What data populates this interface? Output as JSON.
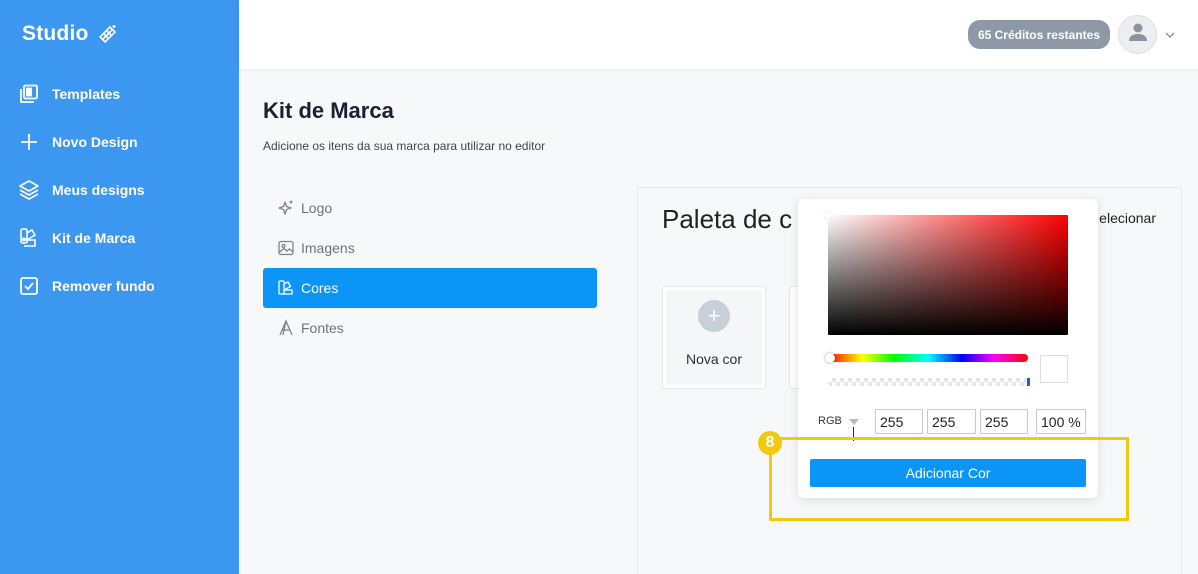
{
  "brand": {
    "name": "Studio",
    "icon": "magic-wand-icon"
  },
  "sidebar": {
    "items": [
      {
        "label": "Templates",
        "icon": "templates-icon"
      },
      {
        "label": "Novo Design",
        "icon": "plus-icon"
      },
      {
        "label": "Meus designs",
        "icon": "layers-icon"
      },
      {
        "label": "Kit de Marca",
        "icon": "brand-kit-icon"
      },
      {
        "label": "Remover fundo",
        "icon": "checkbox-icon"
      }
    ]
  },
  "header": {
    "credits": "65 Créditos restantes",
    "avatar_icon": "user-icon",
    "menu_icon": "chevron-down-icon"
  },
  "main": {
    "title": "Kit de Marca",
    "subtitle": "Adicione os itens da sua marca para utilizar no editor",
    "tabs": [
      {
        "label": "Logo",
        "icon": "sparkle-icon"
      },
      {
        "label": "Imagens",
        "icon": "image-icon"
      },
      {
        "label": "Cores",
        "icon": "palette-icon",
        "active": true
      },
      {
        "label": "Fontes",
        "icon": "font-icon"
      }
    ],
    "panel": {
      "title": "Paleta de c",
      "action": "elecionar",
      "new_color_label": "Nova cor",
      "new_color_symbol": "+"
    }
  },
  "color_picker": {
    "mode": "RGB",
    "r": "255",
    "g": "255",
    "b": "255",
    "alpha": "100 %",
    "hue_color": "#ff0000",
    "selected_color": "#ffffff",
    "add_button": "Adicionar Cor"
  },
  "tutorial": {
    "step": "8",
    "highlight_color": "#f2c90e"
  },
  "colors": {
    "sidebar": "#3b97ef",
    "accent": "#0b96f7",
    "credits_badge": "#8e99a8"
  }
}
